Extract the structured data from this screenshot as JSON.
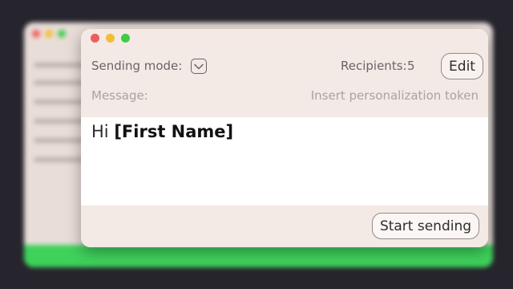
{
  "window": {
    "traffic_colors": [
      "#ec5e5b",
      "#f3be36",
      "#3fcb48"
    ]
  },
  "header": {
    "sending_mode_label": "Sending mode:",
    "recipients_label": "Recipients:",
    "recipients_count": "5",
    "edit_label": "Edit"
  },
  "message": {
    "label": "Message:",
    "insert_token_label": "Insert personalization token",
    "greeting": "Hi",
    "token": "[First Name]"
  },
  "footer": {
    "start_label": "Start sending"
  },
  "colors": {
    "background": "#26252d",
    "panel": "#f3e9e5",
    "accent_green": "#3ed25b"
  }
}
